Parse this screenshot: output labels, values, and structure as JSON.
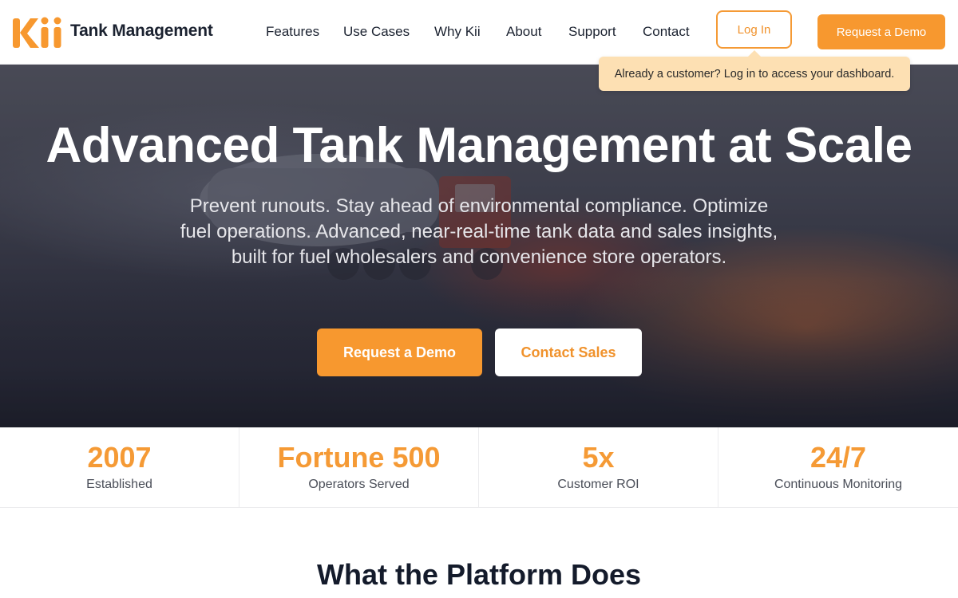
{
  "header": {
    "logo_text": "Kii",
    "brand_name": "Tank Management",
    "nav": [
      "Features",
      "Use Cases",
      "Why Kii",
      "About",
      "Support",
      "Contact"
    ],
    "login_label": "Log In",
    "demo_label": "Request a Demo",
    "login_tooltip": "Already a customer? Log in to access your dashboard."
  },
  "hero": {
    "title": "Advanced Tank Management at Scale",
    "subtitle": "Prevent runouts. Stay ahead of environmental compliance. Optimize fuel operations. Advanced, near-real-time tank data and sales insights, built for fuel wholesalers and convenience store operators.",
    "primary_cta": "Request a Demo",
    "secondary_cta": "Contact Sales",
    "background_image": "fuel tanker truck on highway at sunset"
  },
  "stats": [
    {
      "value": "2007",
      "label": "Established"
    },
    {
      "value": "Fortune 500",
      "label": "Operators Served"
    },
    {
      "value": "5x",
      "label": "Customer ROI"
    },
    {
      "value": "24/7",
      "label": "Continuous Monitoring"
    }
  ],
  "section": {
    "title": "What the Platform Does"
  },
  "colors": {
    "accent": "#f7982f",
    "text_dark": "#1b2230",
    "tooltip_bg": "#fde0b3"
  }
}
